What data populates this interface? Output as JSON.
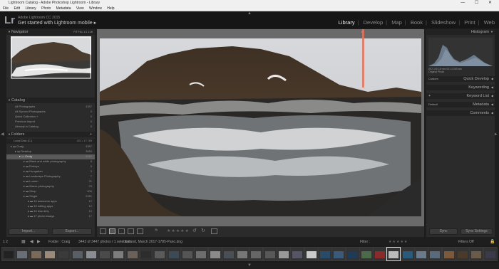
{
  "window": {
    "title": "Lightroom Catalog - Adobe Photoshop Lightroom - Library",
    "controls": "— ☐ ✕"
  },
  "menu": [
    "File",
    "Edit",
    "Library",
    "Photo",
    "Metadata",
    "View",
    "Window",
    "Help"
  ],
  "identity": {
    "logo": "Lr",
    "app_name": "Adobe Lightroom CC 2015",
    "get_started": "Get started with Lightroom mobile"
  },
  "modules": [
    {
      "label": "Library",
      "active": true
    },
    {
      "label": "Develop"
    },
    {
      "label": "Map"
    },
    {
      "label": "Book"
    },
    {
      "label": "Slideshow"
    },
    {
      "label": "Print"
    },
    {
      "label": "Web"
    }
  ],
  "left_panel": {
    "navigator": {
      "title": "Navigator",
      "zoom": "FIT  FILL  1:1  1:16"
    },
    "catalog": {
      "title": "Catalog",
      "items": [
        {
          "label": "All Photographs",
          "count": "4387"
        },
        {
          "label": "All Synced Photographs",
          "count": "0"
        },
        {
          "label": "Quick Collection +",
          "count": "0"
        },
        {
          "label": "Previous Import",
          "count": "0"
        },
        {
          "label": "Already in Catalog",
          "count": "0"
        }
      ]
    },
    "folders": {
      "title": "Folders",
      "volume": "Local Disk (C:)",
      "volume_size": "421 / 1T GB",
      "items": [
        {
          "label": "Craig",
          "count": "4387",
          "indent": 1
        },
        {
          "label": "Desktop",
          "count": "3650",
          "indent": 2
        },
        {
          "label": "Craig",
          "count": "3442",
          "indent": 3,
          "selected": true
        },
        {
          "label": "Black and white photography",
          "count": "8",
          "indent": 4
        },
        {
          "label": "Embryo",
          "count": "5",
          "indent": 4
        },
        {
          "label": "Hungarian",
          "count": "3",
          "indent": 4
        },
        {
          "label": "Landscape Photography",
          "count": "7",
          "indent": 4
        },
        {
          "label": "Lumen",
          "count": "31",
          "indent": 4
        },
        {
          "label": "Macro photography",
          "count": "23",
          "indent": 4
        },
        {
          "label": "Shop",
          "count": "606",
          "indent": 4
        },
        {
          "label": "Single",
          "count": "2281",
          "indent": 4
        },
        {
          "label": "10 awesome apps",
          "count": "12",
          "indent": 5
        },
        {
          "label": "10 editing apps",
          "count": "12",
          "indent": 5
        },
        {
          "label": "10 less dirty",
          "count": "10",
          "indent": 5
        },
        {
          "label": "17 photo essays",
          "count": "17",
          "indent": 5
        }
      ]
    },
    "import_label": "Import...",
    "export_label": "Export..."
  },
  "right_panel": {
    "histogram": {
      "title": "Histogram",
      "info": "ISO 100   16 mm   f/11   1/160 sec",
      "original": "Original Photo"
    },
    "sections": [
      {
        "label": "Quick Develop",
        "preset": "Custom"
      },
      {
        "label": "Keywording"
      },
      {
        "label": "Keyword List"
      },
      {
        "label": "Metadata",
        "preset": "Default"
      },
      {
        "label": "Comments"
      }
    ],
    "sync_label": "Sync",
    "sync_settings_label": "Sync Settings"
  },
  "toolbar": {
    "stars": "★★★★★"
  },
  "filmbar": {
    "pages": "1  2",
    "folder": "Folder : Craig",
    "status": "3442 of 3447 photos / 1 selected",
    "file": "/ Iceland, March 2017-1785-Pano.dng",
    "filter_label": "Filter :",
    "filters_off": "Filters Off"
  },
  "filmstrip_colors": [
    "#222",
    "#6a6f77",
    "#7a6a5a",
    "#9a8a7a",
    "#3a3a3a",
    "#5a5f66",
    "#8a8e93",
    "#4a4a4a",
    "#7d7d7d",
    "#6a625a",
    "#2d2d2d",
    "#5a5a5a",
    "#3c4a55",
    "#555",
    "#6d6d6d",
    "#8a8a8a",
    "#4a4f55",
    "#777",
    "#666",
    "#585858",
    "#999",
    "#556",
    "#c9c9c9",
    "#2a4a6a",
    "#3a5a7a",
    "#1f3a55",
    "#4a6a4a",
    "#8a2a2a",
    "#bbb",
    "#2a5a7a",
    "#6a7a8a",
    "#5a6a7a",
    "#7a5a3a",
    "#4a3a2a",
    "#6a5a4a",
    "#3a3a4a"
  ]
}
